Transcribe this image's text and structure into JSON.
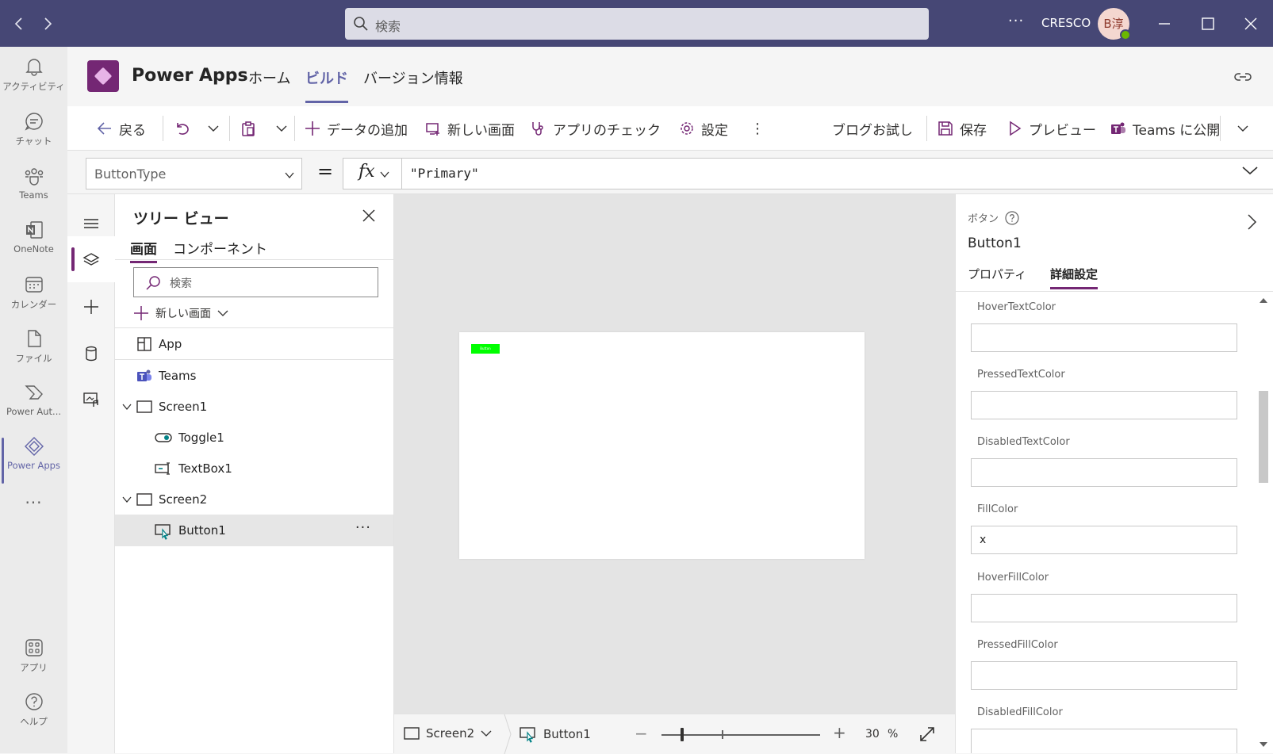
{
  "titlebar": {
    "search_placeholder": "検索",
    "more": "···",
    "org": "CRESCO",
    "avatar_initials": "B淳",
    "status_color": "#6bb700",
    "accent": "#464775"
  },
  "rail": {
    "items": [
      {
        "label": "アクティビティ",
        "icon": "bell-icon"
      },
      {
        "label": "チャット",
        "icon": "chat-icon"
      },
      {
        "label": "Teams",
        "icon": "teams-icon"
      },
      {
        "label": "OneNote",
        "icon": "onenote-icon"
      },
      {
        "label": "カレンダー",
        "icon": "calendar-icon"
      },
      {
        "label": "ファイル",
        "icon": "file-icon"
      },
      {
        "label": "Power Aut...",
        "icon": "power-automate-icon"
      },
      {
        "label": "Power Apps",
        "icon": "power-apps-icon",
        "active": true
      }
    ],
    "more": "···",
    "apps_label": "アプリ",
    "help_label": "ヘルプ"
  },
  "app": {
    "title": "Power Apps",
    "tabs": [
      "ホーム",
      "ビルド",
      "バージョン情報"
    ],
    "active_tab": "ビルド",
    "brand_color": "#742774"
  },
  "commandbar": {
    "back": "戻る",
    "add_data": "データの追加",
    "new_screen": "新しい画面",
    "app_checker": "アプリのチェック",
    "settings": "設定",
    "more": "⋮",
    "blog": "ブログお試し",
    "save": "保存",
    "preview": "プレビュー",
    "publish": "Teams に公開"
  },
  "formulabar": {
    "property": "ButtonType",
    "equals": "=",
    "fx": "fx",
    "value": "\"Primary\""
  },
  "treeview": {
    "title": "ツリー ビュー",
    "tabs": [
      "画面",
      "コンポーネント"
    ],
    "search_placeholder": "検索",
    "new_screen": "新しい画面",
    "nodes": [
      {
        "label": "App",
        "icon": "app-icon"
      },
      {
        "label": "Teams",
        "icon": "teams-icon"
      },
      {
        "label": "Screen1",
        "icon": "screen-icon"
      },
      {
        "label": "Toggle1",
        "icon": "toggle-icon"
      },
      {
        "label": "TextBox1",
        "icon": "textbox-icon"
      },
      {
        "label": "Screen2",
        "icon": "screen-icon"
      },
      {
        "label": "Button1",
        "icon": "button-icon",
        "selected": true
      }
    ],
    "more": "···"
  },
  "canvas": {
    "button_text": "Button",
    "button_color": "#00ff00"
  },
  "statusbar": {
    "screen": "Screen2",
    "control": "Button1",
    "zoom_minus": "−",
    "zoom_plus": "+",
    "zoom_value": "30",
    "zoom_unit": "%"
  },
  "properties": {
    "control_type": "ボタン",
    "control_name": "Button1",
    "tabs": [
      "プロパティ",
      "詳細設定"
    ],
    "active_tab": "詳細設定",
    "fields": [
      {
        "label": "HoverTextColor",
        "value": ""
      },
      {
        "label": "PressedTextColor",
        "value": ""
      },
      {
        "label": "DisabledTextColor",
        "value": ""
      },
      {
        "label": "FillColor",
        "value": "x"
      },
      {
        "label": "HoverFillColor",
        "value": ""
      },
      {
        "label": "PressedFillColor",
        "value": ""
      },
      {
        "label": "DisabledFillColor",
        "value": ""
      }
    ]
  }
}
